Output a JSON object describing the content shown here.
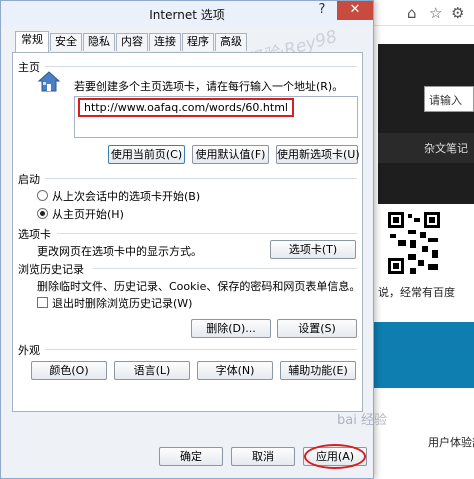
{
  "dialog": {
    "title": "Internet 选项",
    "help_glyph": "?",
    "close_glyph": "✕"
  },
  "tabs": [
    "常规",
    "安全",
    "隐私",
    "内容",
    "连接",
    "程序",
    "高级"
  ],
  "home": {
    "label": "主页",
    "hint": "若要创建多个主页选项卡，请在每行输入一个地址(R)。",
    "url": "http://www.oafaq.com/words/60.html",
    "btn_current": "使用当前页(C)",
    "btn_default": "使用默认值(F)",
    "btn_newtab": "使用新选项卡(U)"
  },
  "startup": {
    "label": "启动",
    "option_last": "从上次会话中的选项卡开始(B)",
    "option_home": "从主页开始(H)"
  },
  "tabs_section": {
    "label": "选项卡",
    "text": "更改网页在选项卡中的显示方式。",
    "button": "选项卡(T)"
  },
  "history": {
    "label": "浏览历史记录",
    "text": "删除临时文件、历史记录、Cookie、保存的密码和网页表单信息。",
    "checkbox": "退出时删除浏览历史记录(W)",
    "btn_delete": "删除(D)...",
    "btn_settings": "设置(S)"
  },
  "appearance": {
    "label": "外观",
    "btn_colors": "颜色(O)",
    "btn_languages": "语言(L)",
    "btn_fonts": "字体(N)",
    "btn_accessibility": "辅助功能(E)"
  },
  "footer": {
    "ok": "确定",
    "cancel": "取消",
    "apply": "应用(A)"
  },
  "background": {
    "input_text": "请输入",
    "nav_text": "杂文笔记",
    "line1": "说，经常有百度",
    "footer_text": "用户体验部"
  },
  "watermark": "百度经验·Rey98",
  "watermark2": "bai 经验"
}
